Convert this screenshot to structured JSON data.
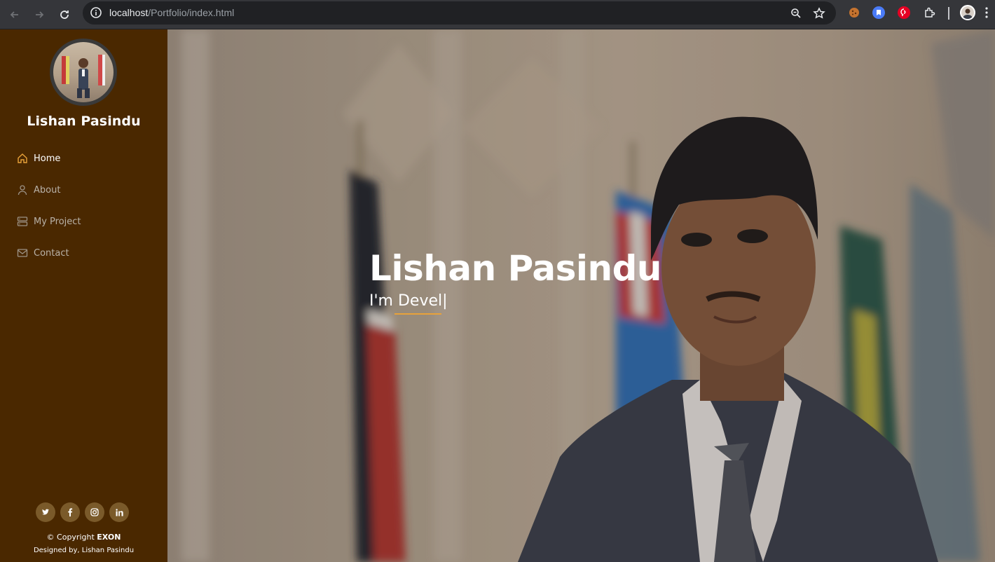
{
  "browser": {
    "url_host": "localhost",
    "url_path": "/Portfolio/index.html"
  },
  "sidebar": {
    "profile_name": "Lishan Pasindu",
    "items": [
      {
        "label": "Home",
        "icon": "home-icon",
        "active": true
      },
      {
        "label": "About",
        "icon": "user-icon",
        "active": false
      },
      {
        "label": "My Project",
        "icon": "server-icon",
        "active": false
      },
      {
        "label": "Contact",
        "icon": "envelope-icon",
        "active": false
      }
    ],
    "socials": [
      {
        "icon": "twitter-icon",
        "glyph": "t"
      },
      {
        "icon": "facebook-icon",
        "glyph": "f"
      },
      {
        "icon": "instagram-icon",
        "glyph": "◎"
      },
      {
        "icon": "linkedin-icon",
        "glyph": "in"
      }
    ],
    "copyright_prefix": "© Copyright",
    "copyright_brand": "EXON",
    "designed_by": "Designed by, Lishan Pasindu"
  },
  "hero": {
    "title": "Lishan Pasindu",
    "subtitle_prefix": "I'm",
    "typed_text": "Devel|"
  },
  "colors": {
    "sidebar_bg": "#4a2800",
    "accent": "#e8a23a",
    "active_icon": "#e8a23a"
  }
}
